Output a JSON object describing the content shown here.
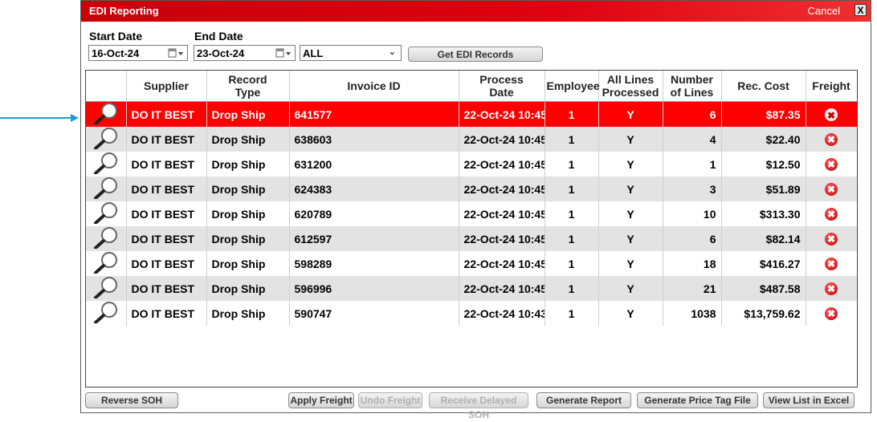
{
  "window": {
    "title": "EDI Reporting",
    "cancel_label": "Cancel",
    "close_label": "X"
  },
  "filters": {
    "start_date_label": "Start Date",
    "start_date_value": "16-Oct-24",
    "end_date_label": "End Date",
    "end_date_value": "23-Oct-24",
    "type_value": "ALL",
    "get_records_label": "Get EDI Records"
  },
  "table": {
    "headers": {
      "supplier": "Supplier",
      "record_type_1": "Record",
      "record_type_2": "Type",
      "invoice_id": "Invoice ID",
      "process_date_1": "Process",
      "process_date_2": "Date",
      "employee": "Employee",
      "all_lines_1": "All Lines",
      "all_lines_2": "Processed",
      "num_lines_1": "Number",
      "num_lines_2": "of Lines",
      "rec_cost": "Rec. Cost",
      "freight": "Freight"
    },
    "selected_index": 0,
    "rows": [
      {
        "supplier": "DO IT BEST",
        "record_type": "Drop Ship",
        "invoice_id": "641577",
        "process_date": "22-Oct-24 10:45",
        "employee": "1",
        "all_lines": "Y",
        "num_lines": "6",
        "rec_cost": "$87.35"
      },
      {
        "supplier": "DO IT BEST",
        "record_type": "Drop Ship",
        "invoice_id": "638603",
        "process_date": "22-Oct-24 10:45",
        "employee": "1",
        "all_lines": "Y",
        "num_lines": "4",
        "rec_cost": "$22.40"
      },
      {
        "supplier": "DO IT BEST",
        "record_type": "Drop Ship",
        "invoice_id": "631200",
        "process_date": "22-Oct-24 10:45",
        "employee": "1",
        "all_lines": "Y",
        "num_lines": "1",
        "rec_cost": "$12.50"
      },
      {
        "supplier": "DO IT BEST",
        "record_type": "Drop Ship",
        "invoice_id": "624383",
        "process_date": "22-Oct-24 10:45",
        "employee": "1",
        "all_lines": "Y",
        "num_lines": "3",
        "rec_cost": "$51.89"
      },
      {
        "supplier": "DO IT BEST",
        "record_type": "Drop Ship",
        "invoice_id": "620789",
        "process_date": "22-Oct-24 10:45",
        "employee": "1",
        "all_lines": "Y",
        "num_lines": "10",
        "rec_cost": "$313.30"
      },
      {
        "supplier": "DO IT BEST",
        "record_type": "Drop Ship",
        "invoice_id": "612597",
        "process_date": "22-Oct-24 10:45",
        "employee": "1",
        "all_lines": "Y",
        "num_lines": "6",
        "rec_cost": "$82.14"
      },
      {
        "supplier": "DO IT BEST",
        "record_type": "Drop Ship",
        "invoice_id": "598289",
        "process_date": "22-Oct-24 10:45",
        "employee": "1",
        "all_lines": "Y",
        "num_lines": "18",
        "rec_cost": "$416.27"
      },
      {
        "supplier": "DO IT BEST",
        "record_type": "Drop Ship",
        "invoice_id": "596996",
        "process_date": "22-Oct-24 10:45",
        "employee": "1",
        "all_lines": "Y",
        "num_lines": "21",
        "rec_cost": "$487.58"
      },
      {
        "supplier": "DO IT BEST",
        "record_type": "Drop Ship",
        "invoice_id": "590747",
        "process_date": "22-Oct-24 10:43",
        "employee": "1",
        "all_lines": "Y",
        "num_lines": "1038",
        "rec_cost": "$13,759.62"
      }
    ]
  },
  "buttons": {
    "reverse_soh": "Reverse SOH",
    "apply_freight": "Apply Freight",
    "undo_freight": "Undo Freight",
    "receive_delayed_soh": "Receive Delayed SOH",
    "generate_report": "Generate Report",
    "generate_price_tag_file": "Generate Price Tag File",
    "view_list_excel": "View List in Excel"
  },
  "icons": {
    "row_view": "magnifier-icon",
    "freight": "remove-freight-icon",
    "pointer": "arrow-right-icon"
  },
  "colors": {
    "title_bar": "#e00010",
    "selected_row": "#ff0000",
    "alt_row": "#e3e3e3",
    "pointer_arrow": "#1a9ad6"
  }
}
